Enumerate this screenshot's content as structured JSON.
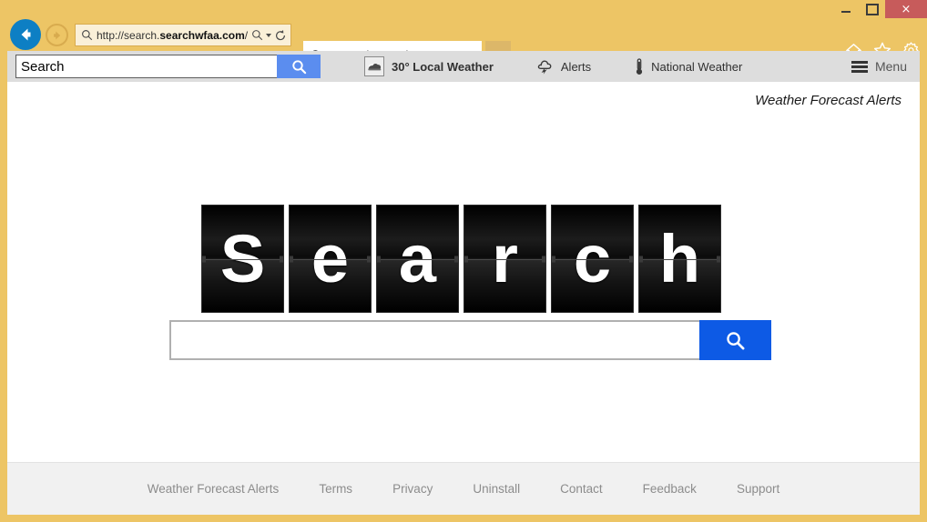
{
  "window": {
    "minimize_label": "",
    "maximize_label": "",
    "close_label": "×",
    "titlebar_color": "#edc565",
    "close_button_color": "#c75b5b"
  },
  "navigation": {
    "back_label": "Back",
    "forward_label": "Forward",
    "address_url_prefix": "http://search.",
    "address_url_bold": "searchwfaa.com",
    "address_url_suffix": "/",
    "address_url_full": "http://search.searchwfaa.com/",
    "search_in_page_icon": "magnifier-icon",
    "dropdown_icon": "caret-down-icon",
    "refresh_icon": "refresh-icon",
    "home_icon": "home-icon",
    "favorites_icon": "star-icon",
    "settings_icon": "gear-icon"
  },
  "tabs": [
    {
      "title": "New Tab Search",
      "icon": "magnifier-icon",
      "close_label": "×",
      "active": true
    }
  ],
  "toolbar": {
    "search_value": "Search",
    "search_placeholder": "Search",
    "search_button_icon": "magnifier-icon",
    "search_button_color": "#5b8def",
    "items": [
      {
        "label": "30° Local Weather",
        "icon": "cloud-icon"
      },
      {
        "label": "Alerts",
        "icon": "alert-cloud-icon"
      },
      {
        "label": "National Weather",
        "icon": "thermometer-icon"
      }
    ],
    "menu_label": "Menu",
    "menu_icon": "hamburger-icon"
  },
  "page": {
    "top_right_label": "Weather Forecast Alerts",
    "logo_letters": [
      "S",
      "e",
      "a",
      "r",
      "c",
      "h"
    ],
    "logo_text": "Search",
    "search_value": "",
    "search_placeholder": "",
    "search_button_icon": "magnifier-icon",
    "search_button_color": "#0d5ae5",
    "footer_links": [
      "Weather Forecast Alerts",
      "Terms",
      "Privacy",
      "Uninstall",
      "Contact",
      "Feedback",
      "Support"
    ]
  }
}
